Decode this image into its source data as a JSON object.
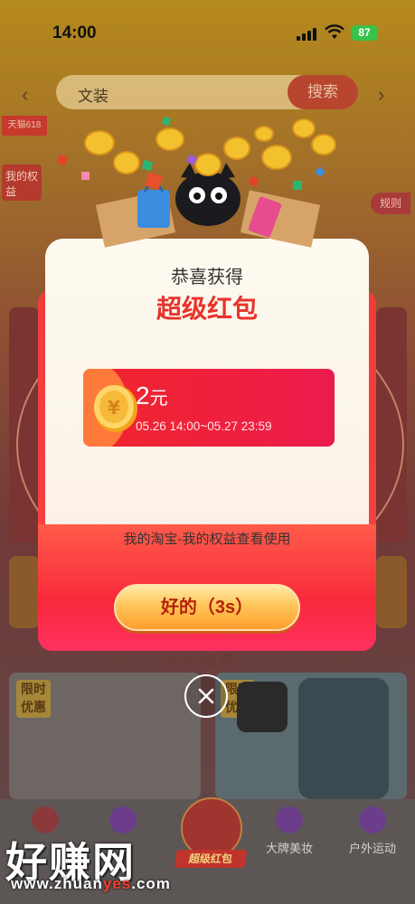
{
  "status_bar": {
    "time": "14:00",
    "battery": "87"
  },
  "search": {
    "value": "文装",
    "button_label": "搜索"
  },
  "background": {
    "promo_tag": "天猫618",
    "my_rights": "我的权益",
    "rules": "规则",
    "recommend_title": "为你推荐",
    "limited_badge": "限时优惠"
  },
  "modal": {
    "congrats": "恭喜获得",
    "title": "超级红包",
    "coupon": {
      "amount": "2",
      "unit": "元",
      "period": "05.26 14:00~05.27 23:59"
    },
    "usage_hint": "我的淘宝-我的权益查看使用",
    "ok_button": "好的（3s）"
  },
  "tab_bar": {
    "center_label": "超级红包",
    "items": [
      {
        "label": "大牌美妆"
      },
      {
        "label": "户外运动"
      }
    ]
  },
  "watermark": {
    "text": "好赚网",
    "url_prefix": "www.zhuan",
    "url_highlight": "yes",
    "url_suffix": ".com"
  },
  "colors": {
    "modal_red": "#f23c3c",
    "title_red": "#e8332b",
    "button_gold": "#ffc65a"
  }
}
